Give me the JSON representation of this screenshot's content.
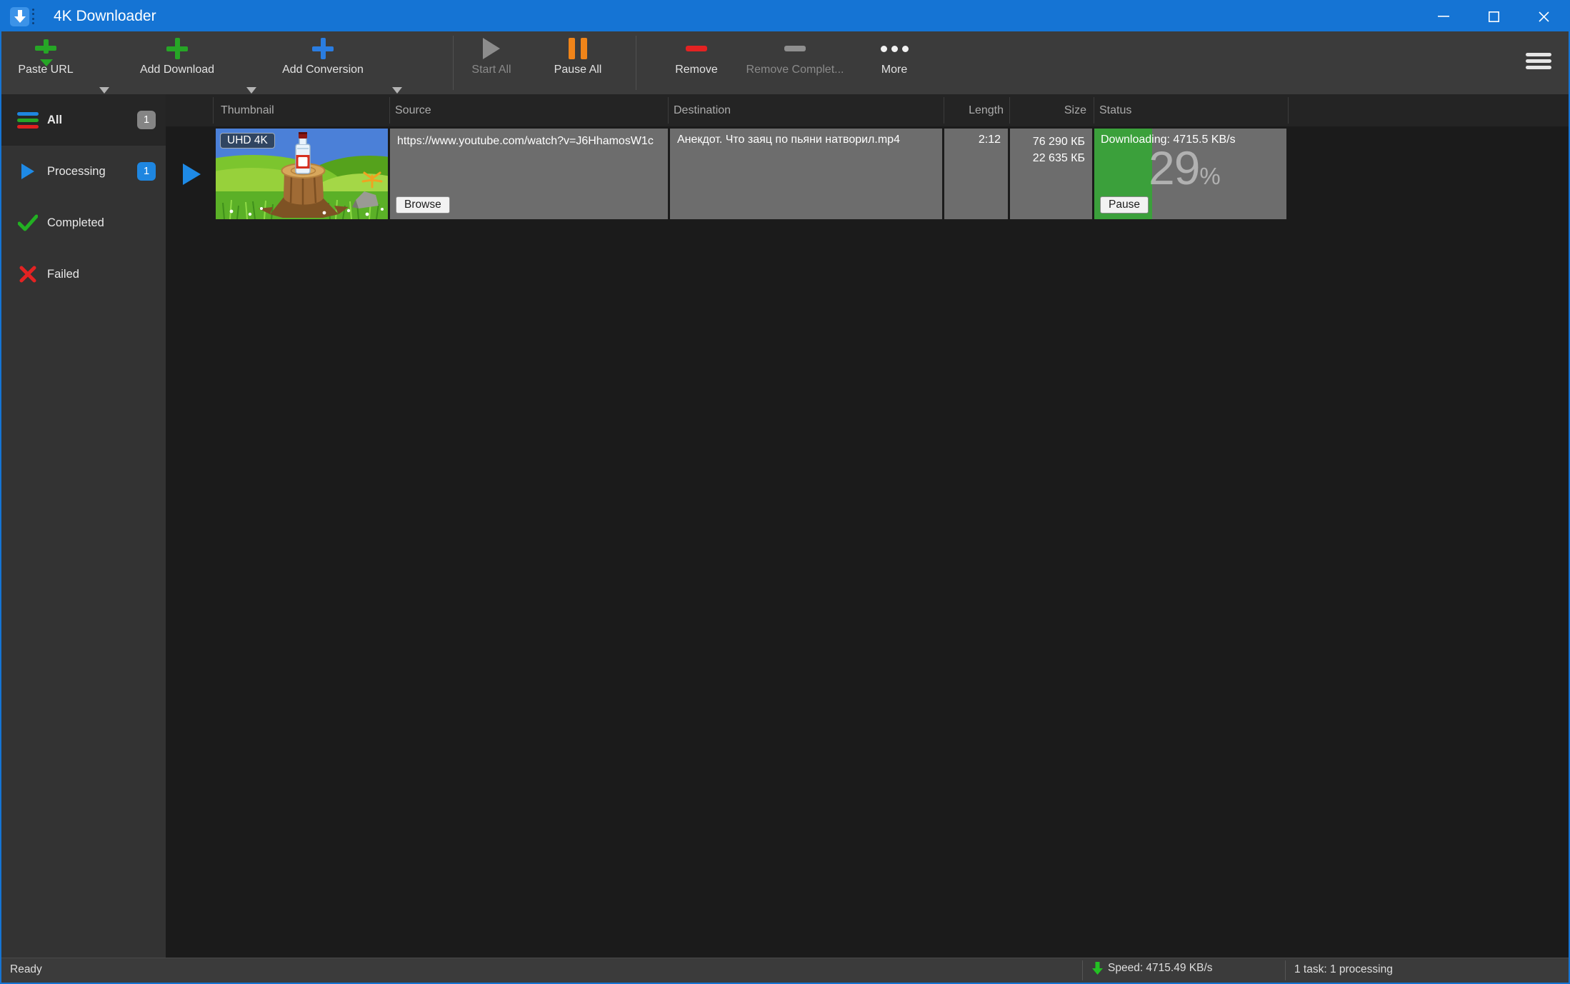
{
  "window": {
    "title": "4K Downloader",
    "controls": {
      "minimize": "minimize",
      "maximize": "maximize",
      "close": "close"
    }
  },
  "toolbar": {
    "buttons": [
      {
        "label": "Paste URL",
        "icon": "paste-url-green-plus-arrow",
        "enabled": true,
        "dropdown": true
      },
      {
        "label": "Add Download",
        "icon": "green-plus",
        "enabled": true,
        "dropdown": true
      },
      {
        "label": "Add Conversion",
        "icon": "blue-plus",
        "enabled": true,
        "dropdown": true
      },
      {
        "label": "Start All",
        "icon": "play-gray",
        "enabled": false,
        "dropdown": false
      },
      {
        "label": "Pause All",
        "icon": "pause-orange",
        "enabled": true,
        "dropdown": false
      },
      {
        "label": "Remove",
        "icon": "minus-red",
        "enabled": true,
        "dropdown": false
      },
      {
        "label": "Remove Complet...",
        "icon": "minus-gray",
        "enabled": false,
        "dropdown": false
      },
      {
        "label": "More",
        "icon": "three-dots",
        "enabled": true,
        "dropdown": false
      }
    ],
    "menu_icon": "hamburger"
  },
  "sidebar": {
    "items": [
      {
        "label": "All",
        "badge": "1",
        "icon": "colored-list",
        "selected": true
      },
      {
        "label": "Processing",
        "badge": "1",
        "icon": "play-blue",
        "selected": false
      },
      {
        "label": "Completed",
        "badge": "",
        "icon": "check-green",
        "selected": false
      },
      {
        "label": "Failed",
        "badge": "",
        "icon": "x-red",
        "selected": false
      }
    ]
  },
  "table": {
    "columns": [
      "Thumbnail",
      "Source",
      "Destination",
      "Length",
      "Size",
      "Status"
    ],
    "rows": [
      {
        "thumbnail_badge": "UHD 4K",
        "source_url": "https://www.youtube.com/watch?v=J6HhamosW1c",
        "browse_label": "Browse",
        "destination": "Анекдот. Что заяц по пьяни натворил.mp4",
        "length": "2:12",
        "size_total": "76 290 КБ",
        "size_downloaded": "22 635 КБ",
        "status_text": "Downloading: 4715.5 KB/s",
        "progress_percent": "29",
        "percent_sign": "%",
        "progress_fraction": 0.3,
        "pause_label": "Pause"
      }
    ]
  },
  "statusbar": {
    "ready": "Ready",
    "speed": "Speed: 4715.49 KB/s",
    "tasks": "1 task: 1 processing"
  },
  "colors": {
    "accent_blue": "#1574d4",
    "progress_green": "#3ba03b",
    "row_gray": "#6d6d6d",
    "pause_orange": "#f08419",
    "remove_red": "#e42222",
    "add_green": "#26a626"
  }
}
